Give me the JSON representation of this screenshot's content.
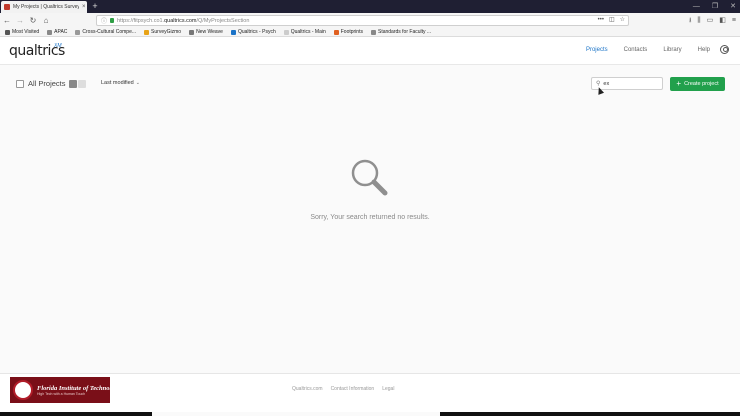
{
  "browser": {
    "tab_title": "My Projects | Qualtrics Survey S",
    "tab_close": "×",
    "new_tab": "+",
    "url_prefix": "https://fitpsych.co1.",
    "url_domain": "qualtrics.com",
    "url_path": "/Q/MyProjectsSection",
    "bookmarks": [
      {
        "label": "Most Visited",
        "color": "#555555"
      },
      {
        "label": "APAC",
        "color": "#888888"
      },
      {
        "label": "Cross-Cultural Compe...",
        "color": "#999999"
      },
      {
        "label": "SurveyGizmo",
        "color": "#e8a317"
      },
      {
        "label": "New Weave",
        "color": "#777777"
      },
      {
        "label": "Qualtrics - Psych",
        "color": "#1a73c7"
      },
      {
        "label": "Qualtrics - Main",
        "color": "#cccccc"
      },
      {
        "label": "Footprints",
        "color": "#e06020"
      },
      {
        "label": "Standards for Faculty ...",
        "color": "#888888"
      }
    ]
  },
  "app": {
    "logo": "qualtrics",
    "logo_suffix": "XM",
    "nav": [
      "Projects",
      "Contacts",
      "Library",
      "Help"
    ],
    "active_nav": "Projects"
  },
  "toolbar": {
    "all_projects": "All Projects",
    "sort_label": "Last modified",
    "search_value": "ex",
    "create_label": "Create project"
  },
  "empty_state": {
    "message": "Sorry, Your search returned no results."
  },
  "footer": {
    "org_name": "Florida Institute of Technology",
    "org_tagline": "High Tech with a Human Touch",
    "links": [
      "Qualtrics.com",
      "Contact Information",
      "Legal"
    ]
  },
  "colors": {
    "accent": "#1a73c7",
    "create_button": "#21a04c",
    "footer_logo_bg": "#7a0f18"
  }
}
